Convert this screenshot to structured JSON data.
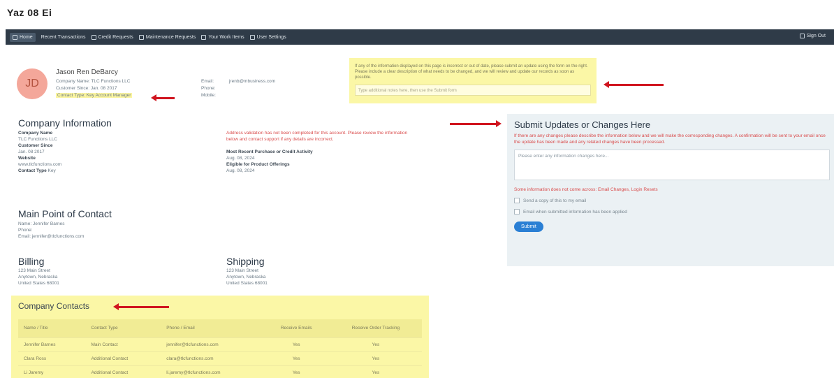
{
  "app": {
    "title": "Yaz 08 Ei"
  },
  "nav": {
    "items": [
      {
        "label": "Home"
      },
      {
        "label": "Recent Transactions"
      },
      {
        "label": "Credit Requests"
      },
      {
        "label": "Maintenance Requests"
      },
      {
        "label": "Your Work Items"
      },
      {
        "label": "User Settings"
      }
    ],
    "right_label": "Sign Out"
  },
  "profile": {
    "initials": "JD",
    "name": "Jason Ren DeBarcy",
    "lines": [
      "Company Name: TLC Functions LLC",
      "Customer Since: Jan. 08 2017"
    ],
    "highlight_line": "Contact Type: Key Account Manager",
    "contact": [
      {
        "label": "Email:",
        "value": "jrenb@mbusiness.com"
      },
      {
        "label": "Phone:",
        "value": ""
      },
      {
        "label": "Mobile:",
        "value": ""
      }
    ]
  },
  "notice": {
    "text": "If any of the information displayed on this page is incorrect or out of date, please submit an update using the form on the right. Please include a clear description of what needs to be changed, and we will review and update our records as soon as possible.",
    "input_placeholder": "Type additional notes here, then use the Submit form"
  },
  "company": {
    "title": "Company Information",
    "left": [
      {
        "k": "Company Name",
        "v": ""
      },
      {
        "k": "",
        "v": "TLC Functions LLC"
      },
      {
        "k": "Customer Since",
        "v": ""
      },
      {
        "k": "",
        "v": "Jan. 08 2017"
      },
      {
        "k": "Website",
        "v": ""
      },
      {
        "k": "",
        "v": "www.tlcfunctions.com"
      },
      {
        "k": "Contact Type",
        "v": "Key"
      }
    ],
    "warning": "Address validation has not been completed for this account. Please review the information below and contact support if any details are incorrect.",
    "right": [
      {
        "k": "Most Recent Purchase or Credit Activity",
        "v": ""
      },
      {
        "k": "",
        "v": "Aug. 08, 2024"
      },
      {
        "k": "Eligible for Product Offerings",
        "v": ""
      },
      {
        "k": "",
        "v": "Aug. 08, 2024"
      }
    ]
  },
  "poc": {
    "title": "Main Point of Contact",
    "lines": [
      "Name: Jennifer Barnes",
      "Phone:",
      "Email: jennifer@tlcfunctions.com"
    ]
  },
  "billing": {
    "title": "Billing",
    "lines": [
      "123 Main Street",
      "Anytown, Nebraska",
      "United States 68001"
    ]
  },
  "shipping": {
    "title": "Shipping",
    "lines": [
      "123 Main Street",
      "Anytown, Nebraska",
      "United States 68001"
    ]
  },
  "update_form": {
    "title": "Submit Updates or Changes Here",
    "description": "If there are any changes please describe the information below and we will make the corresponding changes. A confirmation will be sent to your email once the update has been made and any related changes have been processed.",
    "textarea_placeholder": "Please enter any information changes here...",
    "note": "Some information does not come across: Email Changes, Login Resets",
    "checkboxes": [
      "Send a copy of this to my email",
      "Email when submitted information has been applied"
    ],
    "submit_label": "Submit"
  },
  "contacts": {
    "title": "Company Contacts",
    "columns": [
      "Name / Title",
      "Contact Type",
      "Phone / Email",
      "Receive Emails",
      "Receive Order Tracking"
    ],
    "rows": [
      [
        "Jennifer Barnes",
        "Main Contact",
        "jennifer@tlcfunctions.com",
        "Yes",
        "Yes"
      ],
      [
        "Clara Ross",
        "Additional Contact",
        "clara@tlcfunctions.com",
        "Yes",
        "Yes"
      ],
      [
        "Li Jaremy",
        "Additional Contact",
        "li.jaremy@tlcfunctions.com",
        "Yes",
        "Yes"
      ]
    ]
  },
  "colors": {
    "navbar": "#2f3b48",
    "highlight": "#fbf7a6",
    "arrow": "#d0151f",
    "accent": "#2a7fd4"
  }
}
